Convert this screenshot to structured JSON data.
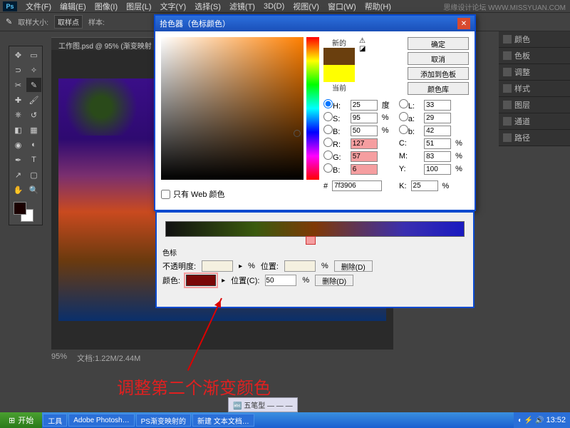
{
  "watermark": "思缘设计论坛  WWW.MISSYUAN.COM",
  "menu": [
    "文件(F)",
    "编辑(E)",
    "图像(I)",
    "图层(L)",
    "文字(Y)",
    "选择(S)",
    "滤镜(T)",
    "3D(D)",
    "视图(V)",
    "窗口(W)",
    "帮助(H)"
  ],
  "options": {
    "sampleSizeLabel": "取样大小:",
    "sampleSize": "取样点",
    "sampleLabel": "样本:"
  },
  "doc": {
    "tab": "工作图.psd @ 95% (渐变映射",
    "zoom": "95%",
    "size": "文档:1.22M/2.44M"
  },
  "panels": [
    "颜色",
    "色板",
    "调整",
    "样式",
    "图层",
    "通道",
    "路径"
  ],
  "colorPicker": {
    "title": "拾色器（色标颜色）",
    "newLabel": "新的",
    "currentLabel": "当前",
    "buttons": {
      "ok": "确定",
      "cancel": "取消",
      "add": "添加到色板",
      "lib": "颜色库"
    },
    "hsb": {
      "H": "25",
      "S": "95",
      "B": "50"
    },
    "lab": {
      "L": "33",
      "a": "29",
      "b": "42"
    },
    "rgb": {
      "R": "127",
      "G": "57",
      "Bl": "6"
    },
    "cmyk": {
      "C": "51",
      "M": "83",
      "Y": "100",
      "K": "25"
    },
    "unitDeg": "度",
    "unitPct": "%",
    "hex": "7f3906",
    "webOnly": "只有 Web 颜色"
  },
  "gradient": {
    "section": "色标",
    "opacityLabel": "不透明度:",
    "posLabel": "位置:",
    "posLabel2": "位置(C):",
    "pos": "50",
    "pct": "%",
    "deleteBtn": "删除(D)",
    "colorLabel": "颜色:"
  },
  "annotation": "调整第二个渐变颜色",
  "ime": "🔤 五笔型 — — —",
  "taskbar": {
    "start": "开始",
    "items": [
      "工具",
      "Adobe Photosh…",
      "PS渐变映射的",
      "新建 文本文档…"
    ],
    "time": "13:52"
  }
}
